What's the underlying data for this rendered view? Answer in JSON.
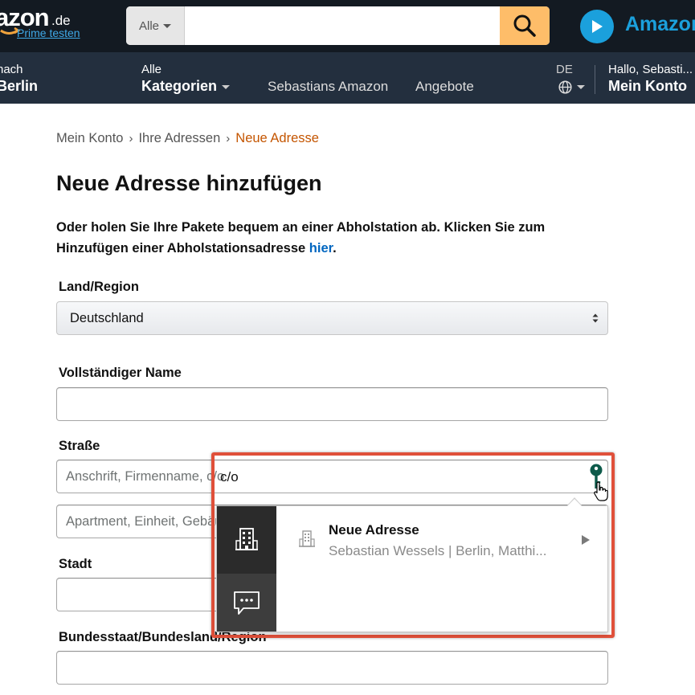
{
  "header": {
    "logo_text": "azon",
    "logo_tld": ".de",
    "prime_link": "Prime testen",
    "search": {
      "scope": "Alle",
      "value": "",
      "placeholder": ""
    },
    "prime_video_label": "Amazon"
  },
  "nav": {
    "location": {
      "line1": "nach",
      "line2": "Berlin"
    },
    "categories": {
      "line1": "Alle",
      "line2": "Kategorien"
    },
    "links": [
      "Sebastians Amazon",
      "Angebote"
    ],
    "language": "DE",
    "account": {
      "line1": "Hallo, Sebasti...",
      "line2": "Mein Konto"
    }
  },
  "breadcrumb": {
    "items": [
      "Mein Konto",
      "Ihre Adressen"
    ],
    "separator": "›",
    "current": "Neue Adresse"
  },
  "page": {
    "title": "Neue Adresse hinzufügen",
    "intro_text": "Oder holen Sie Ihre Pakete bequem an einer Abholstation ab. Klicken Sie zum Hinzufügen einer Abholstationsadresse ",
    "intro_link": "hier",
    "intro_end": "."
  },
  "form": {
    "country": {
      "label": "Land/Region",
      "value": "Deutschland"
    },
    "name": {
      "label": "Vollständiger Name",
      "value": ""
    },
    "street": {
      "label": "Straße",
      "line1_placeholder": "Anschrift, Firmenname, c/o",
      "line2_placeholder": "Apartment, Einheit, Gebäude, Stockwerk usw."
    },
    "city": {
      "label": "Stadt",
      "value": ""
    },
    "state": {
      "label": "Bundesstaat/Bundesland/Region",
      "value": ""
    }
  },
  "autofill": {
    "typed_visible": "c/o",
    "suggestion_title": "Neue Adresse",
    "suggestion_detail": "Sebastian Wessels | Berlin, Matthi..."
  },
  "colors": {
    "header_bg": "#131a22",
    "nav_bg": "#232f3e",
    "search_button": "#febd69",
    "link": "#0066c0",
    "breadcrumb_current": "#c45500",
    "highlight": "#e0503a",
    "key_icon": "#0d5a4a"
  },
  "icons": {
    "search": "magnifier-icon",
    "prime_video": "play-icon",
    "language": "globe-icon",
    "country_select": "updown-arrows-icon",
    "autofill_key": "key-icon",
    "cursor": "hand-pointer-icon",
    "addresses_tab": "building-icon",
    "notes_tab": "speech-bubble-icon",
    "suggestion": "building-icon",
    "expand": "play-arrow-icon"
  }
}
